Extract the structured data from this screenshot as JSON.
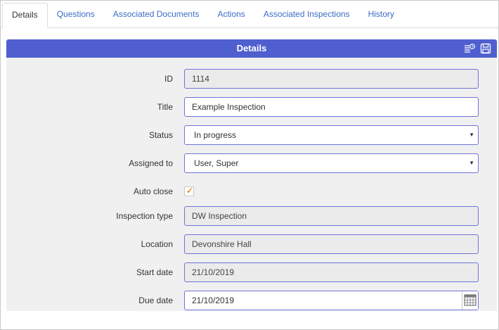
{
  "tabs": [
    {
      "label": "Details",
      "active": true
    },
    {
      "label": "Questions",
      "active": false
    },
    {
      "label": "Associated Documents",
      "active": false
    },
    {
      "label": "Actions",
      "active": false
    },
    {
      "label": "Associated Inspections",
      "active": false
    },
    {
      "label": "History",
      "active": false
    }
  ],
  "panel": {
    "title": "Details",
    "icons": [
      "history-list-icon",
      "save-icon"
    ],
    "header_color": "#4f5fcf"
  },
  "form": {
    "id": {
      "label": "ID",
      "value": "1114"
    },
    "title": {
      "label": "Title",
      "value": "Example Inspection"
    },
    "status": {
      "label": "Status",
      "value": "In progress",
      "caret": "▼"
    },
    "assigned_to": {
      "label": "Assigned to",
      "value": "User, Super",
      "caret": "▼"
    },
    "auto_close": {
      "label": "Auto close",
      "checked": true,
      "mark": "✓"
    },
    "inspection_type": {
      "label": "Inspection type",
      "value": "DW Inspection"
    },
    "location": {
      "label": "Location",
      "value": "Devonshire Hall"
    },
    "start_date": {
      "label": "Start date",
      "value": "21/10/2019"
    },
    "due_date": {
      "label": "Due date",
      "value": "21/10/2019",
      "icon": "calendar-icon"
    }
  }
}
